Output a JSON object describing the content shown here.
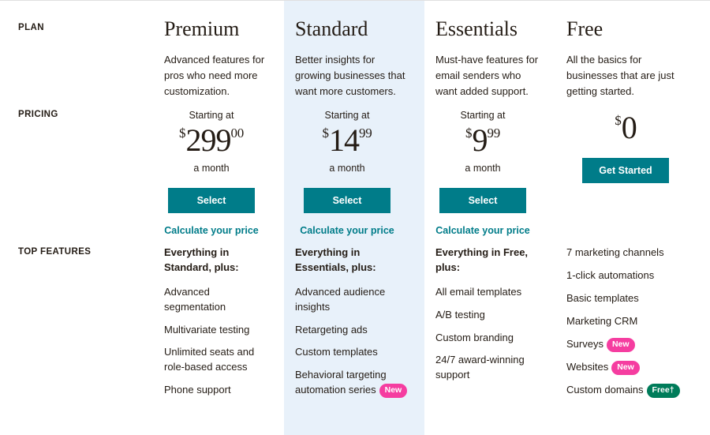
{
  "colors": {
    "accent_teal": "#007C89",
    "highlight_band": "#E8F1FA",
    "badge_new": "#F53DA0",
    "badge_free": "#007C5A",
    "text": "#241C15"
  },
  "row_labels": {
    "plan": "PLAN",
    "pricing": "PRICING",
    "features": "TOP FEATURES"
  },
  "plans": [
    {
      "name": "Premium",
      "description": "Advanced features for pros who need more customization.",
      "highlighted": false,
      "starting_at": "Starting at",
      "currency": "$",
      "amount": "299",
      "cents": "00",
      "per_month": "a month",
      "cta_label": "Select",
      "calc_link": "Calculate your price",
      "features_head": "Everything in Standard, plus:",
      "features": [
        {
          "text": "Advanced segmentation",
          "badge": null
        },
        {
          "text": "Multivariate testing",
          "badge": null
        },
        {
          "text": "Unlimited seats and role-based access",
          "badge": null
        },
        {
          "text": "Phone support",
          "badge": null
        }
      ]
    },
    {
      "name": "Standard",
      "description": "Better insights for growing businesses that want more customers.",
      "highlighted": true,
      "starting_at": "Starting at",
      "currency": "$",
      "amount": "14",
      "cents": "99",
      "per_month": "a month",
      "cta_label": "Select",
      "calc_link": "Calculate your price",
      "features_head": "Everything in Essentials, plus:",
      "features": [
        {
          "text": "Advanced audience insights",
          "badge": null
        },
        {
          "text": "Retargeting ads",
          "badge": null
        },
        {
          "text": "Custom templates",
          "badge": null
        },
        {
          "text": "Behavioral targeting automation series",
          "badge": "New",
          "badge_type": "new"
        }
      ]
    },
    {
      "name": "Essentials",
      "description": "Must-have features for email senders who want added support.",
      "highlighted": false,
      "starting_at": "Starting at",
      "currency": "$",
      "amount": "9",
      "cents": "99",
      "per_month": "a month",
      "cta_label": "Select",
      "calc_link": "Calculate your price",
      "features_head": "Everything in Free, plus:",
      "features": [
        {
          "text": "All email templates",
          "badge": null
        },
        {
          "text": "A/B testing",
          "badge": null
        },
        {
          "text": "Custom branding",
          "badge": null
        },
        {
          "text": "24/7 award-winning support",
          "badge": null
        }
      ]
    },
    {
      "name": "Free",
      "description": "All the basics for businesses that are just getting started.",
      "highlighted": false,
      "starting_at": "",
      "currency": "$",
      "amount": "0",
      "cents": "",
      "per_month": "",
      "cta_label": "Get Started",
      "calc_link": "",
      "features_head": "",
      "features": [
        {
          "text": "7 marketing channels",
          "badge": null
        },
        {
          "text": "1-click automations",
          "badge": null
        },
        {
          "text": "Basic templates",
          "badge": null
        },
        {
          "text": "Marketing CRM",
          "badge": null
        },
        {
          "text": "Surveys",
          "badge": "New",
          "badge_type": "new"
        },
        {
          "text": "Websites",
          "badge": "New",
          "badge_type": "new"
        },
        {
          "text": "Custom domains",
          "badge": "Free†",
          "badge_type": "free"
        }
      ]
    }
  ]
}
